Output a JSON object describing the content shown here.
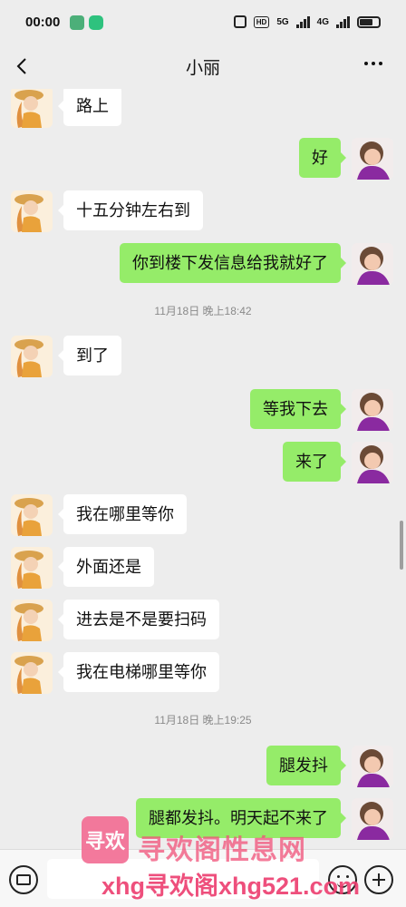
{
  "status_bar": {
    "time": "00:00",
    "network_label": "HD",
    "signal_1": "5G",
    "signal_2": "4G"
  },
  "header": {
    "back_icon": "chevron-left-icon",
    "title": "小丽",
    "more_icon": "ellipsis-icon"
  },
  "messages": [
    {
      "side": "left",
      "text": "路上"
    },
    {
      "side": "right",
      "text": "好"
    },
    {
      "side": "left",
      "text": "十五分钟左右到"
    },
    {
      "side": "right",
      "text": "你到楼下发信息给我就好了"
    },
    {
      "type": "timestamp",
      "text": "11月18日 晚上18:42"
    },
    {
      "side": "left",
      "text": "到了"
    },
    {
      "side": "right",
      "text": "等我下去"
    },
    {
      "side": "right",
      "text": "来了"
    },
    {
      "side": "left",
      "text": "我在哪里等你"
    },
    {
      "side": "left",
      "text": "外面还是"
    },
    {
      "side": "left",
      "text": "进去是不是要扫码"
    },
    {
      "side": "left",
      "text": "我在电梯哪里等你"
    },
    {
      "type": "timestamp",
      "text": "11月18日 晚上19:25"
    },
    {
      "side": "right",
      "text": "腿发抖"
    },
    {
      "side": "right",
      "text": "腿都发抖。明天起不来了"
    }
  ],
  "input_bar": {
    "voice_icon": "keyboard-icon",
    "emoji_icon": "emoji-icon",
    "plus_icon": "plus-icon"
  },
  "watermark": {
    "logo_text": "寻欢",
    "line1": "寻欢阁性息网",
    "line2": "xhg寻欢阁xhg521.com"
  },
  "colors": {
    "background": "#ededed",
    "bubble_sent": "#95ec69",
    "bubble_received": "#ffffff"
  }
}
